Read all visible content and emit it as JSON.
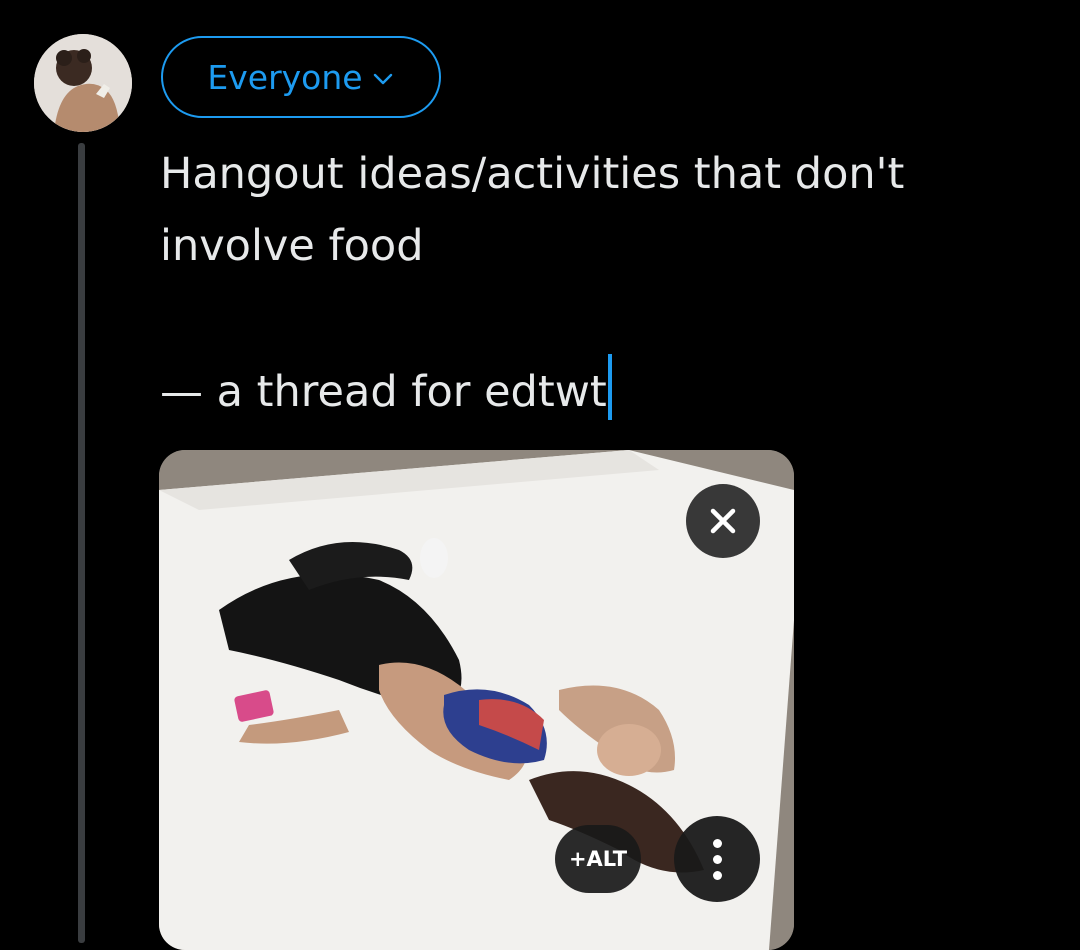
{
  "composer": {
    "audience_label": "Everyone",
    "text_line1": "Hangout ideas/activities that don't involve food",
    "text_line2": "— a thread for edtwt"
  },
  "media": {
    "alt_label": "+ALT"
  },
  "icons": {
    "audience": "chevron-down-icon",
    "close": "close-icon",
    "more": "more-vertical-icon"
  },
  "colors": {
    "background": "#000000",
    "accent": "#1d9bf0",
    "text": "#e7e9ea",
    "thread_line": "#3a3d40"
  }
}
